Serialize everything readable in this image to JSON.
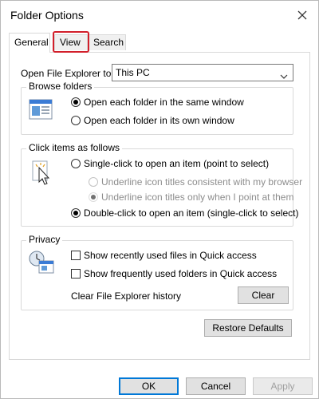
{
  "window": {
    "title": "Folder Options",
    "close_icon": "close-icon"
  },
  "tabs": [
    {
      "label": "General",
      "active": true
    },
    {
      "label": "View",
      "active": false,
      "highlighted": true,
      "highlight_color": "#d21f2b"
    },
    {
      "label": "Search",
      "active": false
    }
  ],
  "open_file_explorer": {
    "label": "Open File Explorer to:",
    "value": "This PC"
  },
  "browse_folders": {
    "title": "Browse folders",
    "icon": "browse-folders-icon",
    "options": [
      {
        "label": "Open each folder in the same window",
        "checked": true
      },
      {
        "label": "Open each folder in its own window",
        "checked": false
      }
    ]
  },
  "click_items": {
    "title": "Click items as follows",
    "icon": "pointer-click-icon",
    "single_click": {
      "label": "Single-click to open an item (point to select)",
      "checked": false
    },
    "underline_consistent": {
      "label": "Underline icon titles consistent with my browser",
      "checked": false,
      "disabled": true
    },
    "underline_point": {
      "label": "Underline icon titles only when I point at them",
      "checked": true,
      "disabled": true
    },
    "double_click": {
      "label": "Double-click to open an item (single-click to select)",
      "checked": true
    }
  },
  "privacy": {
    "title": "Privacy",
    "icon": "privacy-icon",
    "show_recent": {
      "label": "Show recently used files in Quick access",
      "checked": false
    },
    "show_frequent": {
      "label": "Show frequently used folders in Quick access",
      "checked": false
    },
    "clear_label": "Clear File Explorer history",
    "clear_button": "Clear"
  },
  "restore_defaults": "Restore Defaults",
  "footer": {
    "ok": "OK",
    "cancel": "Cancel",
    "apply": "Apply",
    "apply_disabled": true
  },
  "colors": {
    "accent": "#0078d7",
    "highlight": "#d21f2b"
  }
}
